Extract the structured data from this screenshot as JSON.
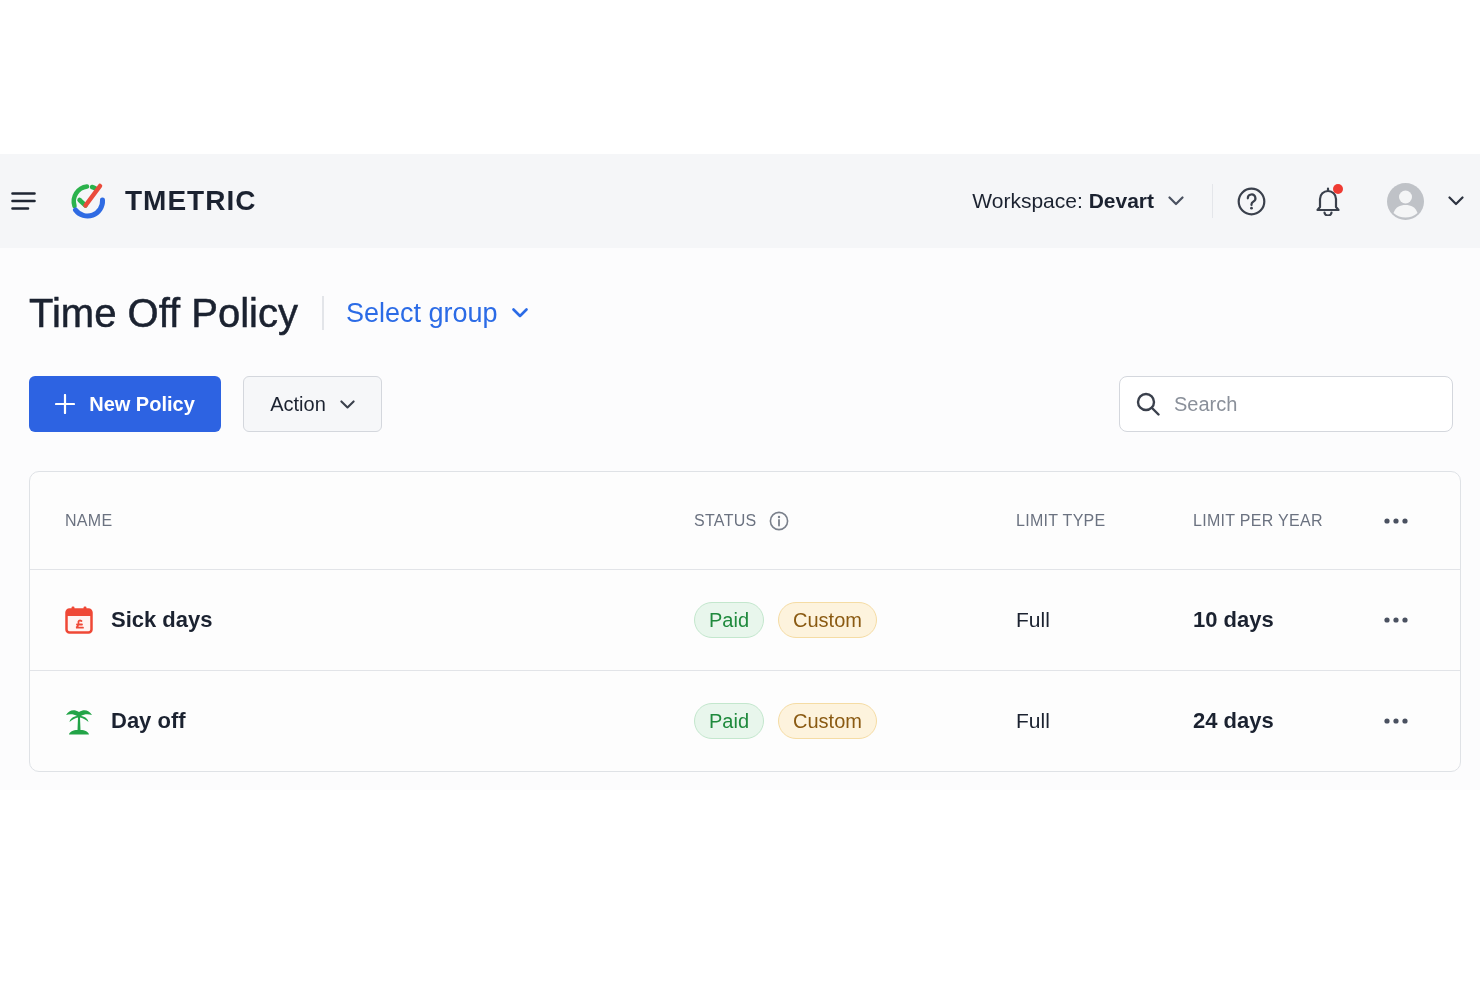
{
  "top_bar": {
    "brand": "TMETRIC",
    "workspace": "Workspace: **Devart**",
    "notifications": {
      "unread": true
    }
  },
  "page": {
    "title": "Time Off Policy",
    "group_selector": "Select group",
    "new_button": "New Policy",
    "action_button": "Action",
    "search": {
      "placeholder": "Search"
    }
  },
  "table": {
    "columns": [
      {
        "label": "NAME",
        "info": false
      },
      {
        "label": "STATUS",
        "info": true
      },
      {
        "label": "LIMIT TYPE",
        "info": false
      },
      {
        "label": "LIMIT PER YEAR",
        "info": false
      }
    ],
    "rows": [
      {
        "name": "Sick days",
        "kind": "calendar",
        "tags": [
          {
            "label": "Paid",
            "kind": "paid"
          },
          {
            "label": "Custom",
            "kind": "custom"
          }
        ],
        "limit_type": "Full",
        "limit_per_year": "10 days"
      },
      {
        "name": "Day off",
        "kind": "palm",
        "tags": [
          {
            "label": "Paid",
            "kind": "paid"
          },
          {
            "label": "Custom",
            "kind": "custom"
          }
        ],
        "limit_type": "Full",
        "limit_per_year": "24 days"
      }
    ]
  }
}
